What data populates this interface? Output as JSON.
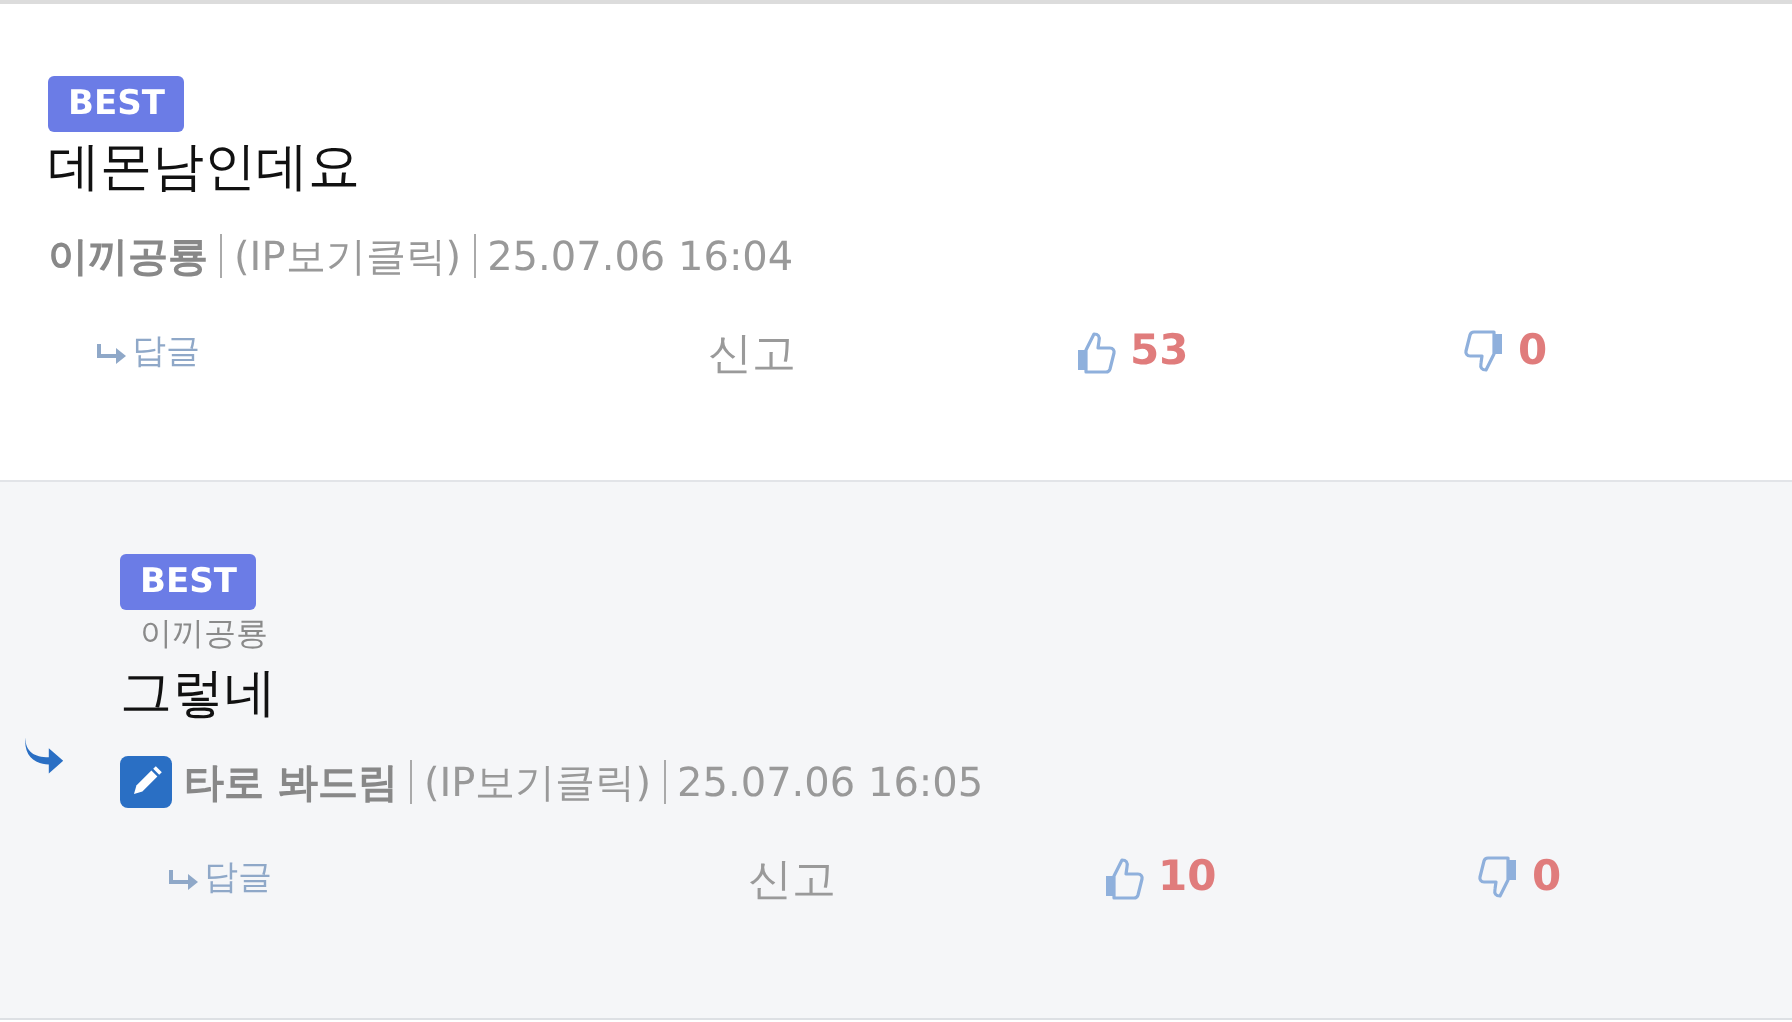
{
  "comments": [
    {
      "kind": "comment",
      "best": true,
      "badge": "BEST",
      "text": "데몬남인데요",
      "author": "이끼공룡",
      "ip": "(IP보기클릭)",
      "date": "25.07.06 16:04",
      "reply_label": "답글",
      "report_label": "신고",
      "likes": "53",
      "dislikes": "0"
    },
    {
      "kind": "reply",
      "best": true,
      "badge": "BEST",
      "reply_to": "이끼공룡",
      "text": "그렇네",
      "writer": true,
      "author": "타로 봐드림",
      "ip": "(IP보기클릭)",
      "date": "25.07.06 16:05",
      "reply_label": "답글",
      "report_label": "신고",
      "likes": "10",
      "dislikes": "0"
    }
  ]
}
